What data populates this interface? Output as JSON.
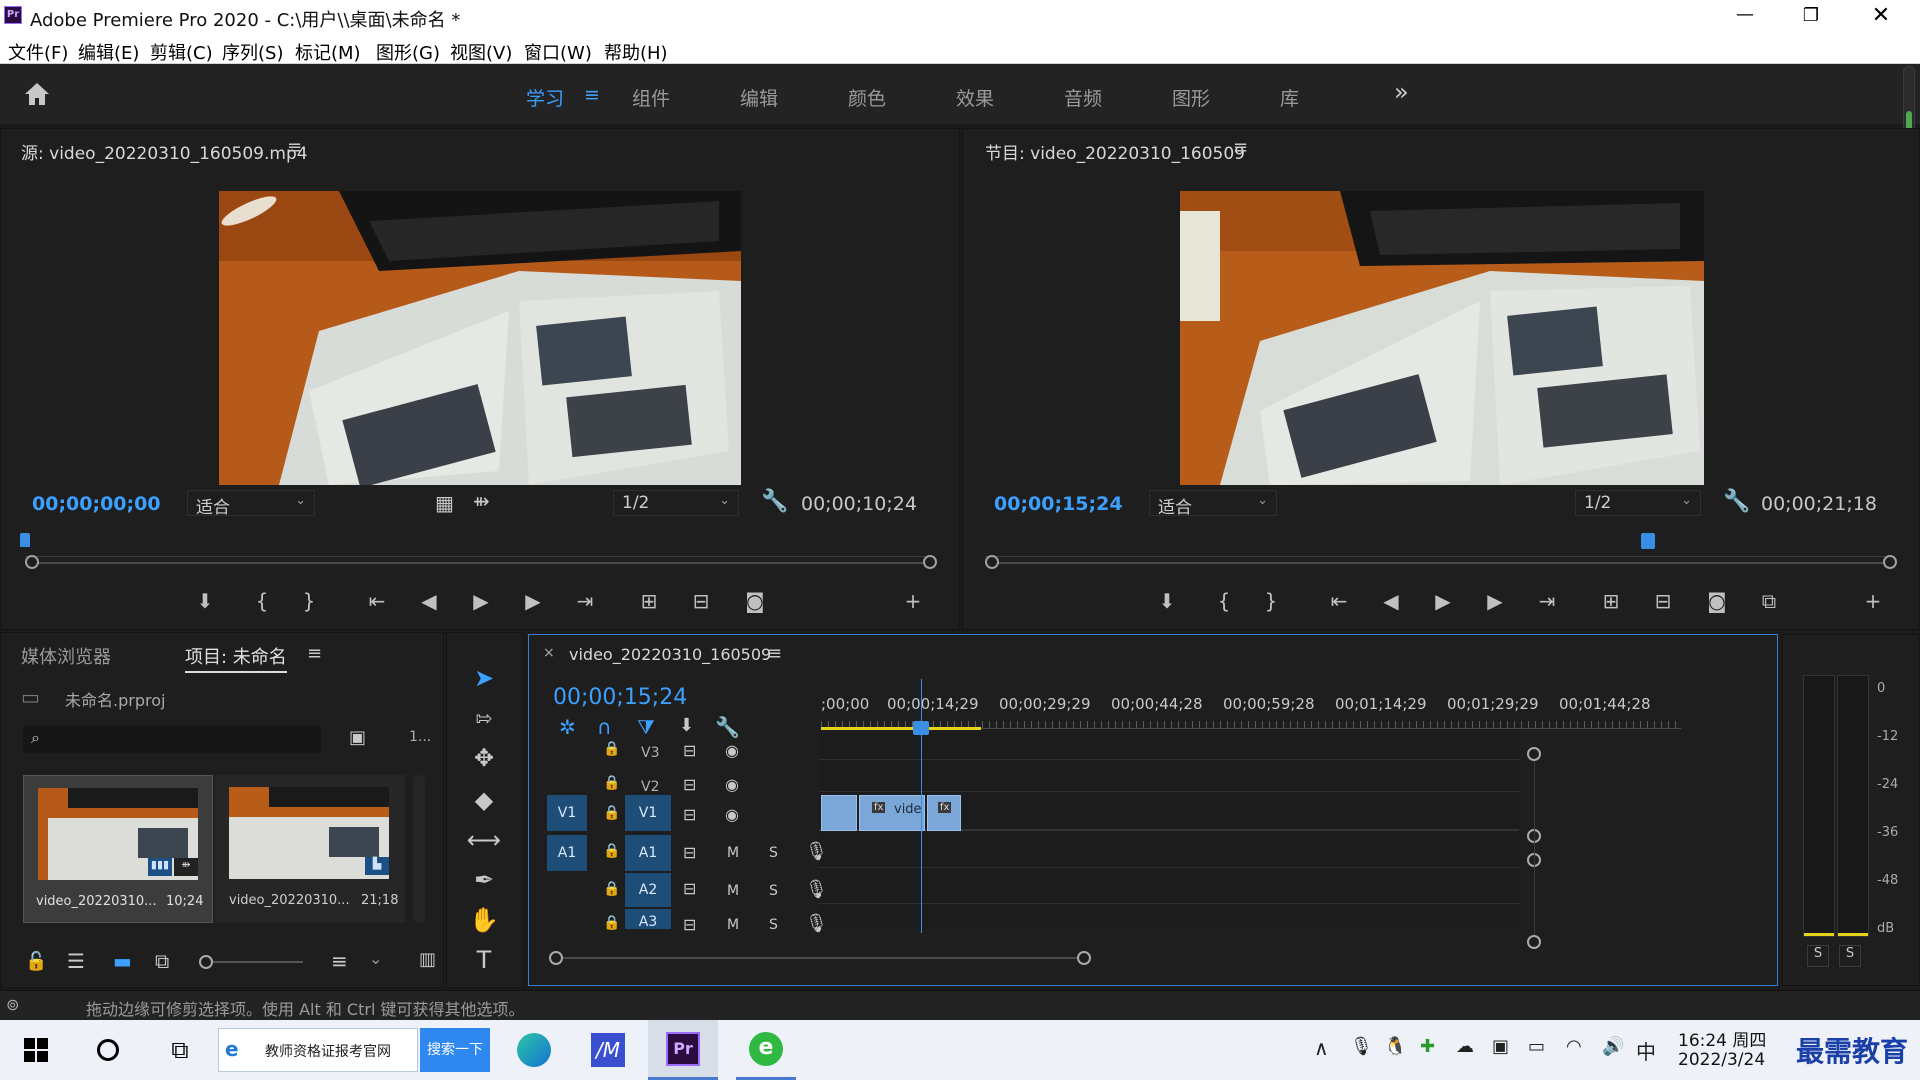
{
  "window": {
    "title": "Adobe Premiere Pro 2020 - C:\\用户\\\\桌面\\未命名 *",
    "app_icon": "Pr"
  },
  "menu": [
    "文件(F)",
    "编辑(E)",
    "剪辑(C)",
    "序列(S)",
    "标记(M)",
    "图形(G)",
    "视图(V)",
    "窗口(W)",
    "帮助(H)"
  ],
  "workspaces": {
    "tabs": [
      "学习",
      "组件",
      "编辑",
      "颜色",
      "效果",
      "音频",
      "图形",
      "库"
    ],
    "active": "学习",
    "more": "»"
  },
  "source_monitor": {
    "title": "源: video_20220310_160509.mp4",
    "timecode": "00;00;00;00",
    "fit": "适合",
    "resolution": "1/2",
    "duration": "00;00;10;24"
  },
  "program_monitor": {
    "title": "节目: video_20220310_160509",
    "timecode": "00;00;15;24",
    "fit": "适合",
    "resolution": "1/2",
    "duration": "00;00;21;18"
  },
  "project_panel": {
    "tab_media": "媒体浏览器",
    "tab_project": "项目: 未命名",
    "file": "未命名.prproj",
    "count": "1...",
    "items": [
      {
        "name": "video_20220310...",
        "duration": "10;24"
      },
      {
        "name": "video_20220310...",
        "duration": "21;18"
      }
    ]
  },
  "timeline": {
    "title": "video_20220310_160509",
    "timecode": "00;00;15;24",
    "ruler": [
      ";00;00",
      "00;00;14;29",
      "00;00;29;29",
      "00;00;44;28",
      "00;00;59;28",
      "00;01;14;29",
      "00;01;29;29",
      "00;01;44;28"
    ],
    "video_tracks": [
      "V3",
      "V2",
      "V1"
    ],
    "audio_tracks": [
      "A1",
      "A2",
      "A3"
    ],
    "source_v": "V1",
    "source_a": "A1",
    "mute": "M",
    "solo": "S",
    "clip_label": "vide",
    "fx": "fx"
  },
  "meter": {
    "scale": [
      "0",
      "-12",
      "-24",
      "-36",
      "-48",
      "dB"
    ],
    "solo_left": "S",
    "solo_right": "S"
  },
  "status": {
    "message": "拖动边缘可修剪选择项。使用 Alt 和 Ctrl 键可获得其他选项。"
  },
  "taskbar": {
    "browser_tab": "教师资格证报考官网",
    "search_button": "搜索一下",
    "pr_label": "Pr",
    "ime": "中",
    "time": "16:24 周四",
    "date": "2022/3/24",
    "watermark": "最需教育"
  },
  "colors": {
    "accent_blue": "#3ca0ff",
    "clip_blue": "#7ba7d8",
    "playhead": "#3a8ee6",
    "work_area": "#e6d41a"
  }
}
